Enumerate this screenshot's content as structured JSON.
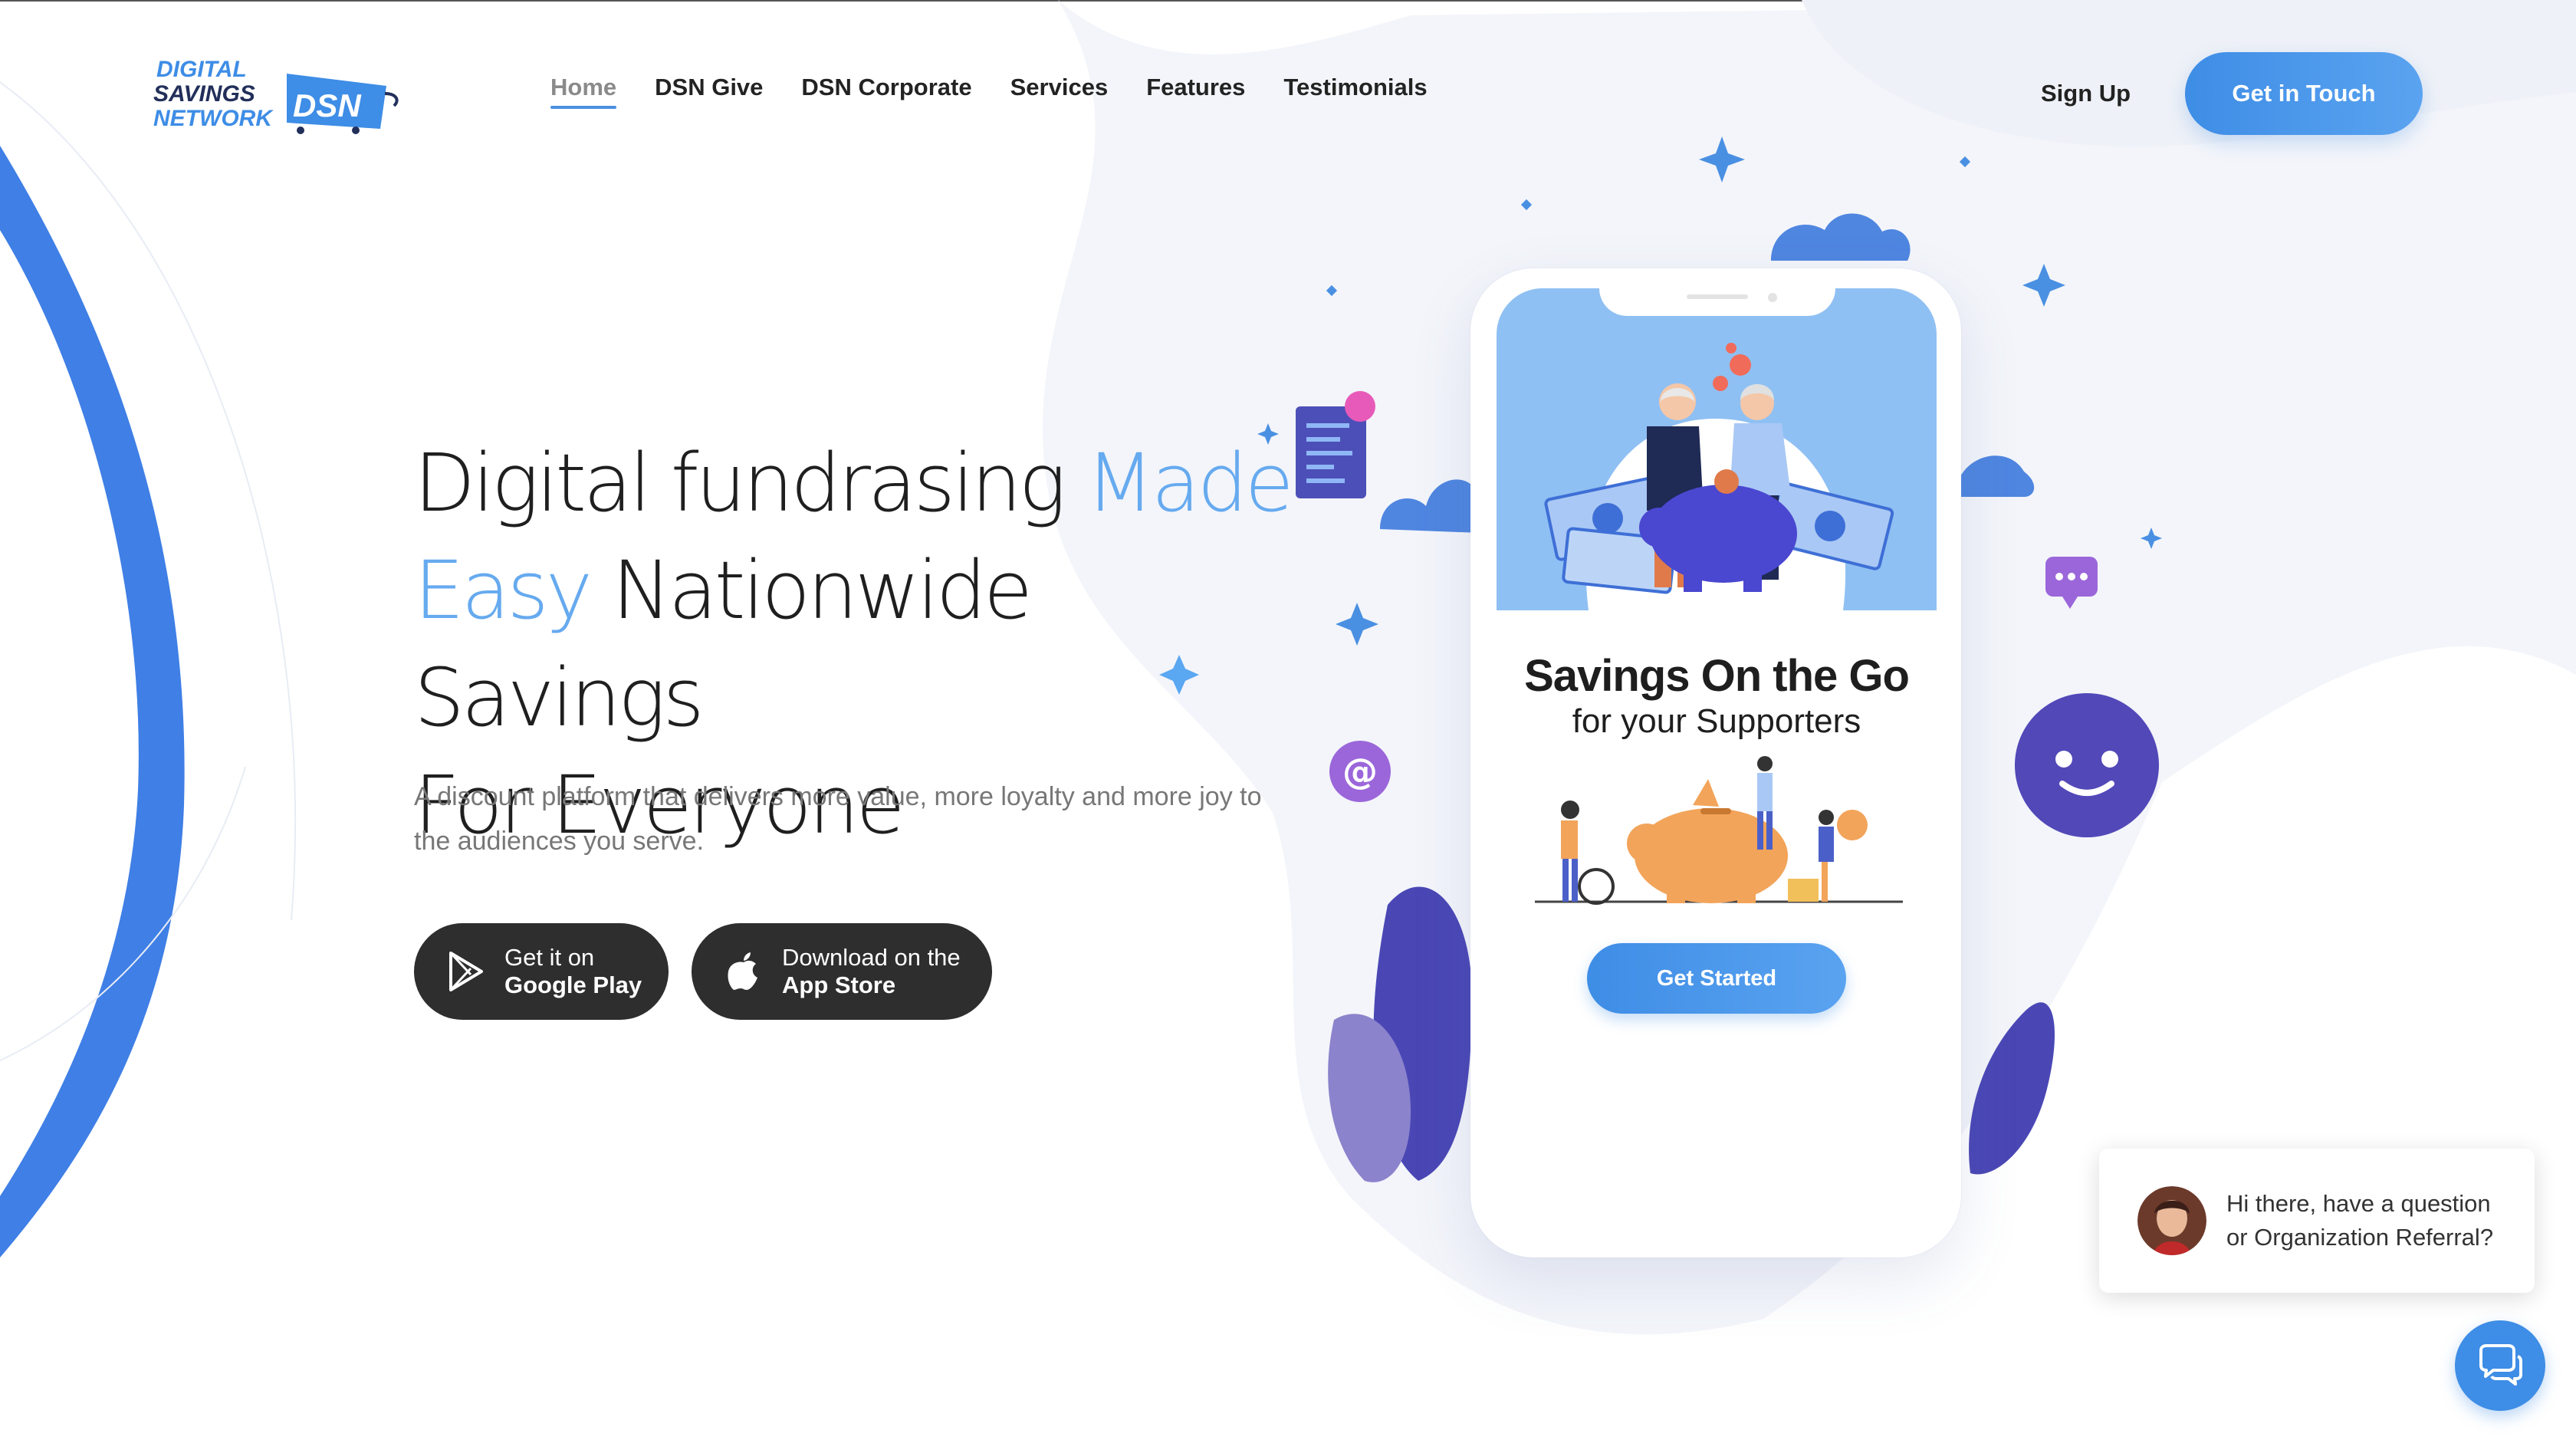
{
  "brand": {
    "logo_line1": "DIGITAL",
    "logo_line2": "SAVINGS",
    "logo_line3": "NETWORK",
    "logo_mark": "DSN",
    "colors": {
      "primary": "#3e8de6",
      "accent_text": "#66aaef",
      "dark_button": "#2e2e2e",
      "purple": "#5248b8"
    }
  },
  "nav": {
    "items": [
      {
        "label": "Home",
        "active": true
      },
      {
        "label": "DSN Give",
        "active": false
      },
      {
        "label": "DSN Corporate",
        "active": false
      },
      {
        "label": "Services",
        "active": false
      },
      {
        "label": "Features",
        "active": false
      },
      {
        "label": "Testimonials",
        "active": false
      }
    ],
    "signup_label": "Sign Up",
    "cta_label": "Get in Touch"
  },
  "hero": {
    "title_part1": "Digital fundrasing ",
    "title_accent1": "Made",
    "title_accent2": "Easy",
    "title_part2": " Nationwide Savings",
    "title_part3": "For Everyone",
    "subtitle": "A discount platform that delivers more value, more loyalty and more joy to the audiences you serve.",
    "google_play": {
      "small": "Get it on",
      "big": "Google Play",
      "icon": "google-play-icon"
    },
    "app_store": {
      "small": "Download on the",
      "big": "App Store",
      "icon": "apple-icon"
    }
  },
  "phone": {
    "heading": "Savings On the Go",
    "subheading": "for your Supporters",
    "button_label": "Get Started"
  },
  "chat": {
    "line1": "Hi there, have a question",
    "line2": "or Organization Referral?",
    "launcher_icon": "chat-bubbles-icon"
  }
}
